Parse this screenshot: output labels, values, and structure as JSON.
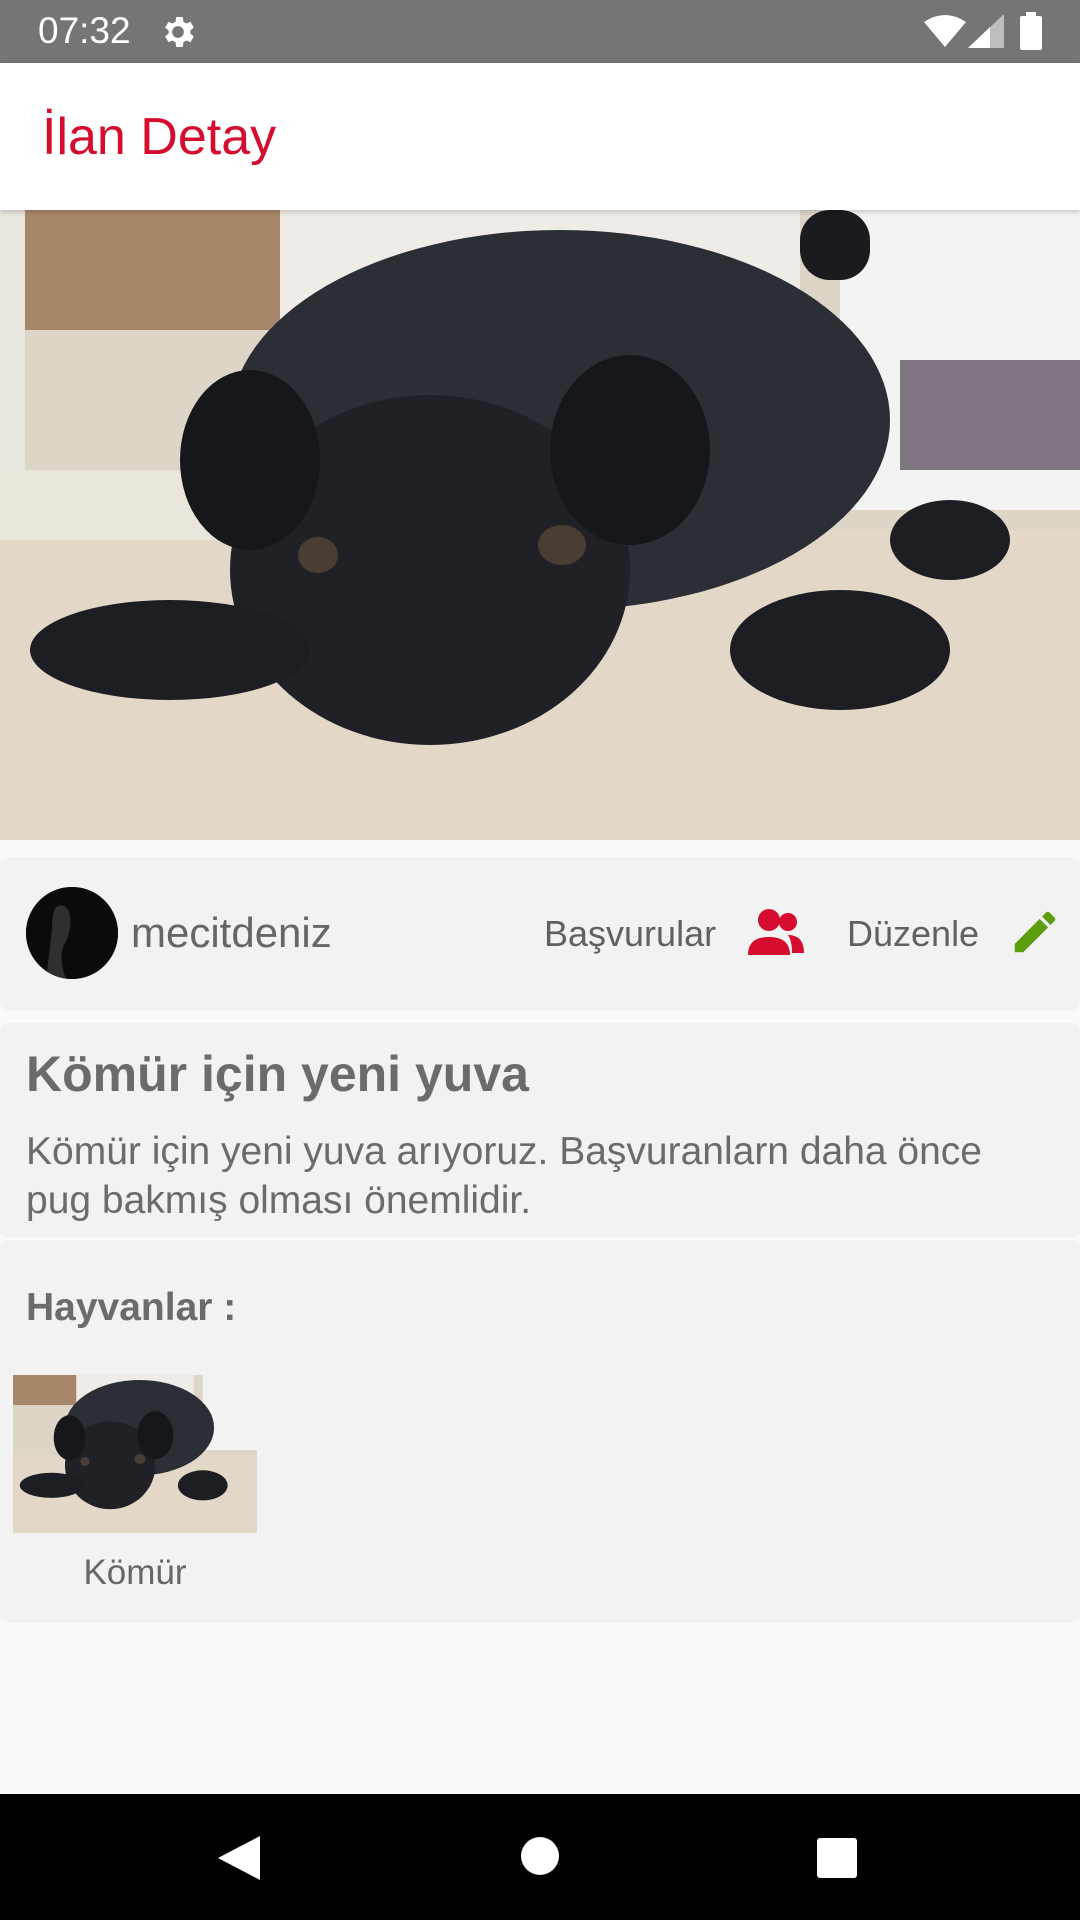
{
  "status_bar": {
    "time": "07:32",
    "icons": [
      "gear-icon",
      "wifi-icon",
      "signal-icon",
      "battery-icon"
    ]
  },
  "app_bar": {
    "title": "İlan Detay",
    "title_color": "#d50c2e"
  },
  "hero": {
    "image": "pug-photo"
  },
  "owner": {
    "username": "mecitdeniz",
    "applicants_label": "Başvurular",
    "applicants_icon": "people-icon",
    "applicants_icon_color": "#d50c2e",
    "edit_label": "Düzenle",
    "edit_icon": "pencil-icon",
    "edit_icon_color": "#5a9e0e"
  },
  "listing": {
    "title": "Kömür için yeni yuva",
    "description": "Kömür için yeni yuva arıyoruz. Başvuranlarn  daha önce pug bakmış olması önemlidir."
  },
  "animals": {
    "heading": "Hayvanlar :",
    "items": [
      {
        "name": "Kömür"
      }
    ]
  },
  "nav_bar": {
    "icons": [
      "back-icon",
      "home-icon",
      "recents-icon"
    ]
  }
}
